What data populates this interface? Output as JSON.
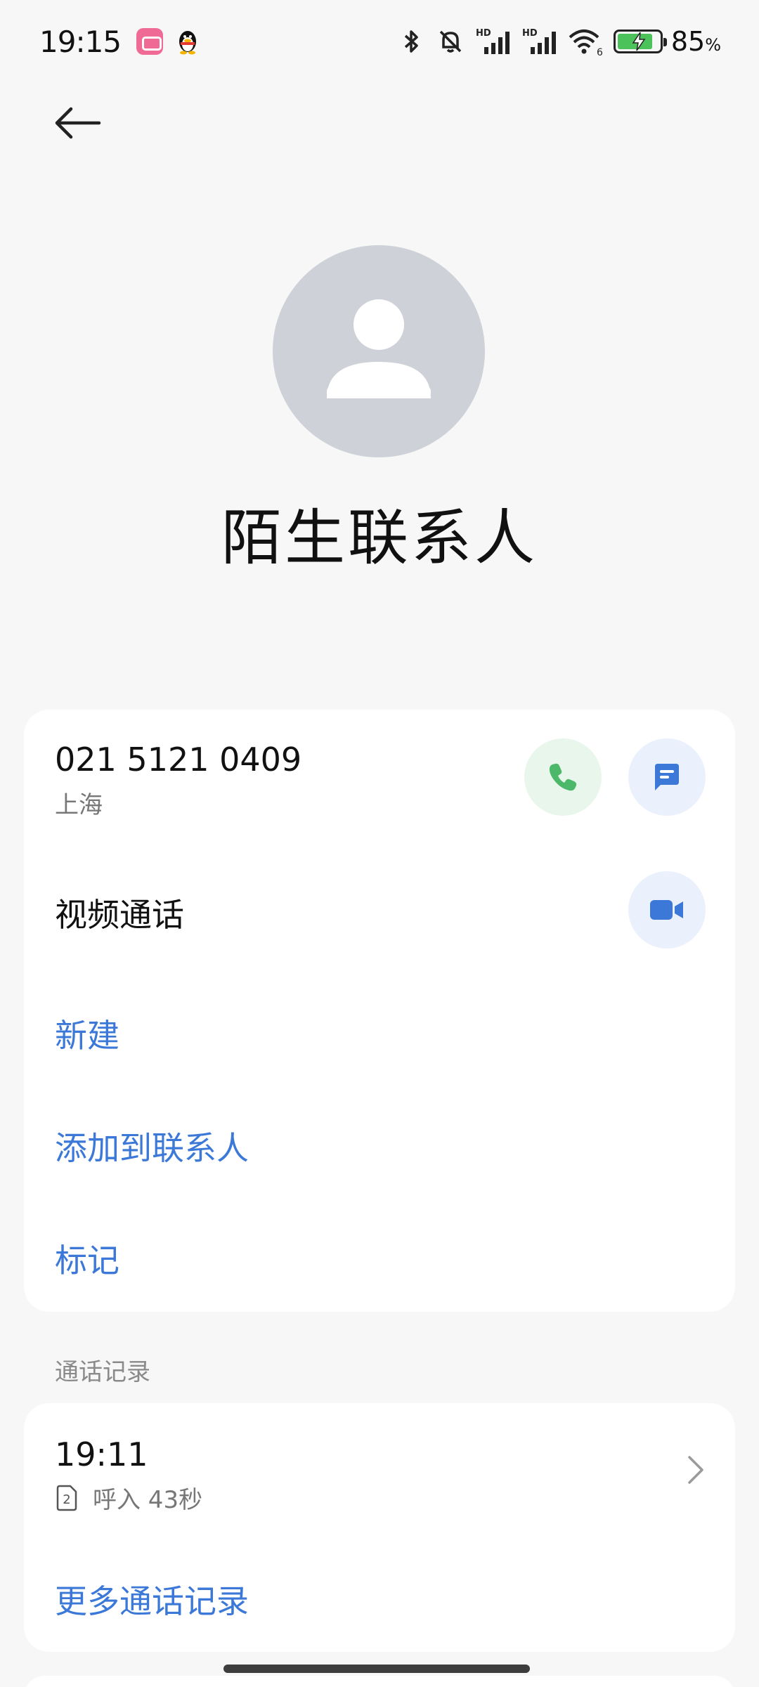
{
  "status_bar": {
    "time": "19:15",
    "battery_level": "85",
    "battery_unit": "%",
    "battery_fraction": 0.85,
    "icons": [
      "bilibili-icon",
      "qq-icon",
      "bluetooth-icon",
      "mute-icon",
      "hd-signal-icon",
      "hd-signal-icon",
      "wifi-icon",
      "battery-charging-icon"
    ],
    "signal_badge": "HD",
    "wifi_badge": "6"
  },
  "contact": {
    "name": "陌生联系人",
    "phone_number": "021 5121 0409",
    "location": "上海"
  },
  "actions": {
    "video_call": "视频通话",
    "new": "新建",
    "add_to_contacts": "添加到联系人",
    "mark": "标记"
  },
  "call_log": {
    "section_title": "通话记录",
    "entries": [
      {
        "time": "19:11",
        "sim": "2",
        "description": "呼入 43秒"
      }
    ],
    "more": "更多通话记录"
  },
  "colors": {
    "accent_blue": "#3b78d8",
    "call_green": "#4cb86a",
    "avatar_gray": "#cfd1d9"
  }
}
